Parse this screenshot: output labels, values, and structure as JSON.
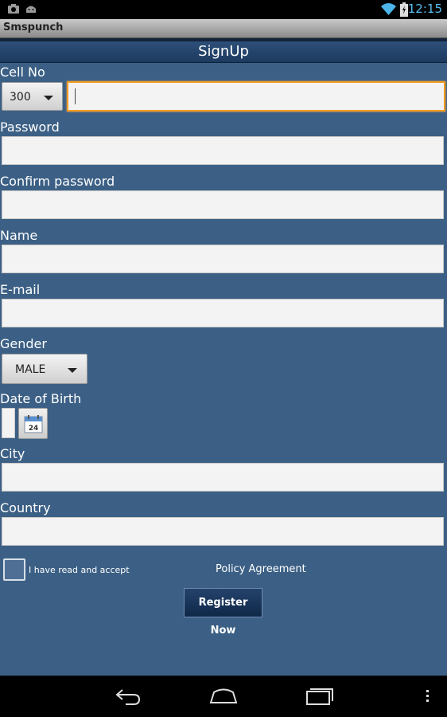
{
  "status_bar": {
    "time": "12:15",
    "icons": [
      "gallery-notification-icon",
      "android-notification-icon",
      "wifi-icon",
      "battery-icon"
    ]
  },
  "app": {
    "title": "Smspunch"
  },
  "header": {
    "title": "SignUp"
  },
  "form": {
    "cell_no_label": "Cell No",
    "cell_prefix_value": "300",
    "cell_input_value": "",
    "password_label": "Password",
    "password_value": "",
    "confirm_password_label": "Confirm password",
    "confirm_password_value": "",
    "name_label": "Name",
    "name_value": "",
    "email_label": "E-mail",
    "email_value": "",
    "gender_label": "Gender",
    "gender_value": "MALE",
    "dob_label": "Date of Birth",
    "calendar_day": "24",
    "city_label": "City",
    "city_value": "",
    "country_label": "Country",
    "country_value": ""
  },
  "agreement": {
    "accept_text": "I have read and accept",
    "policy_link": "Policy Agreement",
    "checked": false
  },
  "register_button": "Register Now",
  "nav_bar": {
    "buttons": [
      "back-icon",
      "home-icon",
      "recent-apps-icon",
      "overflow-menu-icon"
    ]
  },
  "colors": {
    "background": "#3c6085",
    "header": "#1d3a5f",
    "focus_border": "#f39b22",
    "status_accent": "#56bff0"
  }
}
